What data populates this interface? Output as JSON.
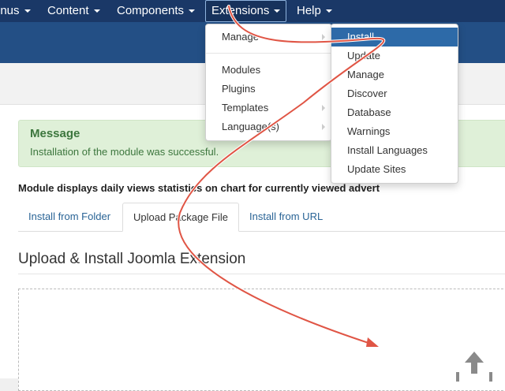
{
  "nav": {
    "menus": "enus",
    "content": "Content",
    "components": "Components",
    "extensions": "Extensions",
    "help": "Help"
  },
  "extensions_menu": {
    "manage": "Manage",
    "modules": "Modules",
    "plugins": "Plugins",
    "templates": "Templates",
    "languages": "Language(s)"
  },
  "manage_submenu": {
    "items": [
      "Install",
      "Update",
      "Manage",
      "Discover",
      "Database",
      "Warnings",
      "Install Languages",
      "Update Sites"
    ],
    "highlighted": "Install"
  },
  "message": {
    "title": "Message",
    "body": "Installation of the module was successful."
  },
  "module_description": "Module displays daily views statistics on chart for currently viewed advert",
  "tabs": [
    "Install from Folder",
    "Upload Package File",
    "Install from URL"
  ],
  "active_tab": "Upload Package File",
  "section_title": "Upload & Install Joomla Extension",
  "icons": {
    "upload": "upload-arrow-icon",
    "annotation": "red-arrow-annotation"
  },
  "colors": {
    "nav_bg": "#1a3867",
    "header_bg": "#234f85",
    "highlight": "#2d6aa8",
    "success_bg": "#dff0d8",
    "success_text": "#3c763d",
    "annotation": "#e05545"
  }
}
